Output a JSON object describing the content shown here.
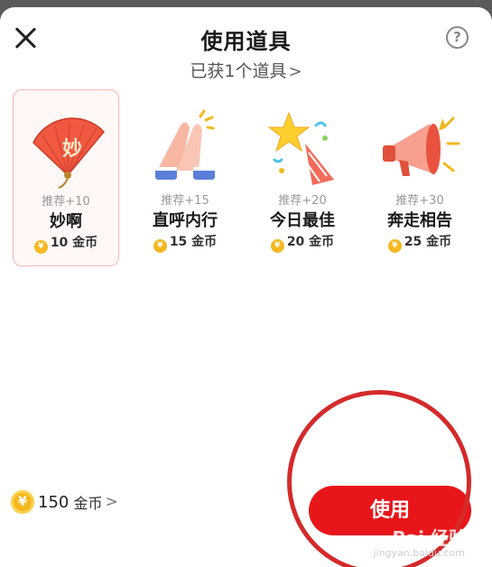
{
  "header": {
    "title": "使用道具",
    "subtitle": "已获1个道具",
    "subtitle_chevron": ">",
    "help_label": "?"
  },
  "items": [
    {
      "recommend": "推荐+10",
      "name": "妙啊",
      "price": "10 金币",
      "icon": "fan-icon"
    },
    {
      "recommend": "推荐+15",
      "name": "直呼内行",
      "price": "15 金币",
      "icon": "clapping-hands-icon"
    },
    {
      "recommend": "推荐+20",
      "name": "今日最佳",
      "price": "20 金币",
      "icon": "star-party-popper-icon"
    },
    {
      "recommend": "推荐+30",
      "name": "奔走相告",
      "price": "25 金币",
      "icon": "megaphone-icon"
    }
  ],
  "coin_glyph": "¥",
  "footer": {
    "balance_value": "150",
    "balance_unit": "金币",
    "balance_chevron": ">",
    "use_button": "使用"
  },
  "watermark": {
    "text": "Bai 经验",
    "sub": "jingyan.baidu.com"
  },
  "colors": {
    "accent": "#e8161a",
    "coin": "#f5b820",
    "selected_border": "#f5b5b5",
    "annotation": "#d42a2a"
  }
}
